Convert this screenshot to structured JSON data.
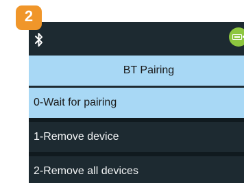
{
  "step": {
    "number": "2",
    "color": "#f0962a"
  },
  "status_bar": {
    "left_icon": "bluetooth-icon",
    "right_icon": "battery-icon",
    "battery_color": "#8dc63f"
  },
  "menu": {
    "title": "BT Pairing",
    "items": [
      {
        "label": "0-Wait for pairing",
        "selected": true
      },
      {
        "label": "1-Remove device",
        "selected": false
      },
      {
        "label": "2-Remove all devices",
        "selected": false
      }
    ]
  },
  "colors": {
    "screen_background": "#1d2a31",
    "highlight": "#a8d8f5"
  }
}
